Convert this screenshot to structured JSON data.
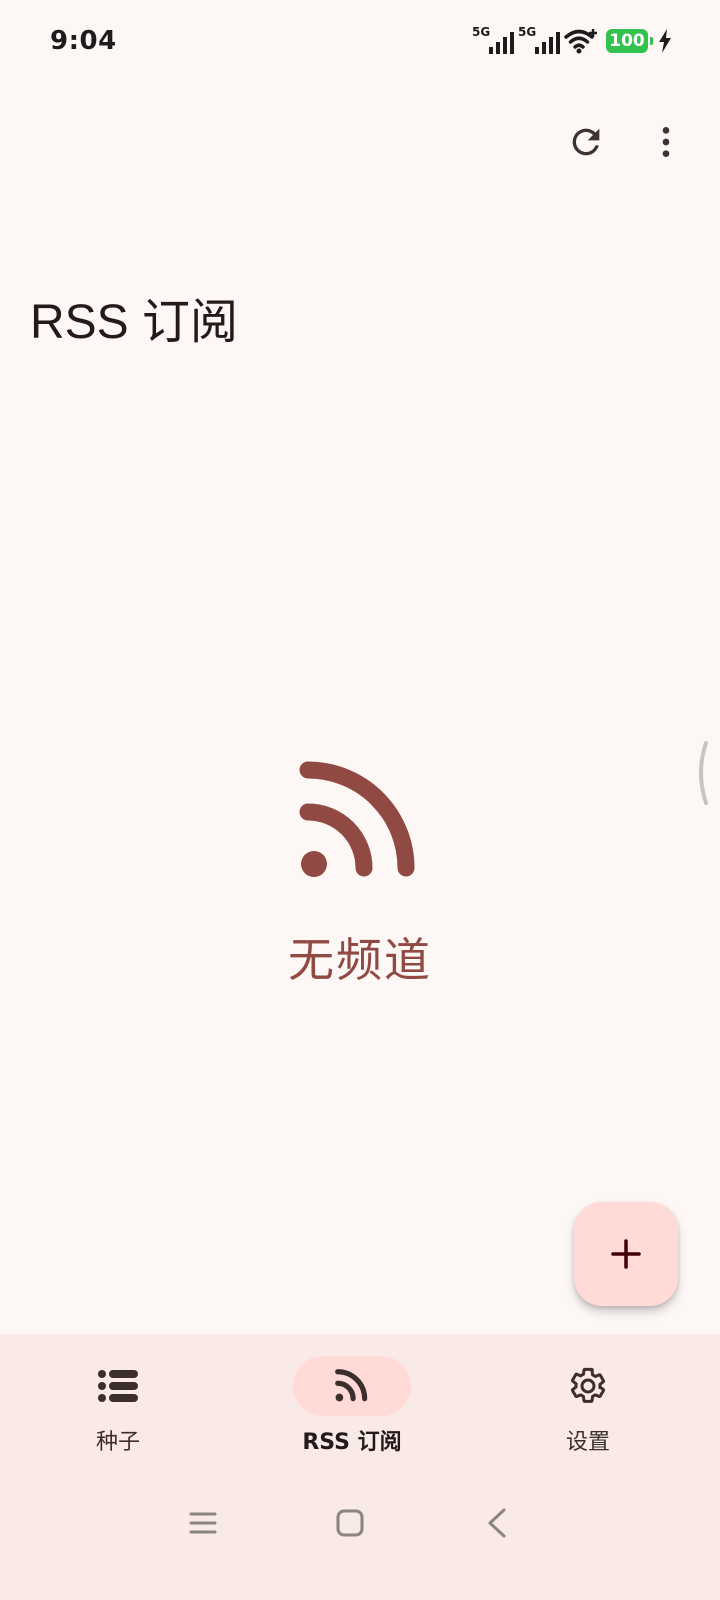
{
  "status_bar": {
    "time": "9:04",
    "sim1_network": "5G",
    "sim2_network": "5G",
    "battery_level": "100",
    "charging": true
  },
  "toolbar": {
    "refresh_icon": "refresh-icon",
    "more_icon": "more-vert-icon"
  },
  "page": {
    "title": "RSS 订阅"
  },
  "empty_state": {
    "icon": "rss-feed-icon",
    "message": "无频道"
  },
  "fab": {
    "icon": "add-icon"
  },
  "bottom_nav": {
    "items": [
      {
        "label": "种子",
        "icon": "list-icon",
        "active": false
      },
      {
        "label": "RSS 订阅",
        "icon": "rss-feed-icon",
        "active": true
      },
      {
        "label": "设置",
        "icon": "gear-icon",
        "active": false
      }
    ]
  },
  "system_nav": {
    "menu_icon": "menu-icon",
    "home_icon": "home-icon",
    "back_icon": "back-icon"
  },
  "colors": {
    "background": "#fdf7f6",
    "primary": "#904a43",
    "primary_container": "#ffdad6",
    "nav_background": "#f9e9e7",
    "battery": "#32c24d"
  }
}
